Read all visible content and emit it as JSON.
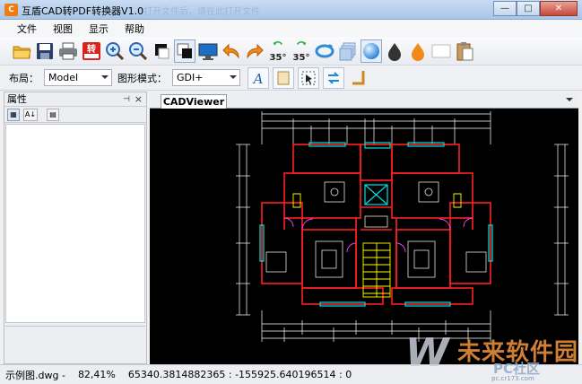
{
  "window": {
    "title": "互盾CAD转PDF转换器V1.0",
    "ghost_title": "打开文件后，请在此打开文件",
    "app_icon_text": "C",
    "btn_minimize": "—",
    "btn_maximize": "□",
    "btn_close": "✕"
  },
  "menu": {
    "items": [
      {
        "label": "文件"
      },
      {
        "label": "视图"
      },
      {
        "label": "显示"
      },
      {
        "label": "帮助"
      }
    ]
  },
  "toolbar": {
    "convert_label": "转",
    "rotate_left_label": "35°",
    "rotate_right_label": "35°",
    "icons": [
      "open-folder-icon",
      "save-icon",
      "print-icon",
      "convert-pdf-icon",
      "zoom-in-icon",
      "zoom-out-icon",
      "black-white-icon",
      "invert-color-icon",
      "monitor-icon",
      "undo-icon",
      "redo-icon",
      "rotate-left-35-icon",
      "rotate-right-35-icon",
      "rotate-icon",
      "layers-icon",
      "sphere-icon",
      "black-drop-icon",
      "orange-drop-icon",
      "white-rect-icon",
      "clipboard-icon"
    ]
  },
  "toolbar2": {
    "layout_label": "布局：",
    "layout_value": "Model",
    "render_label": "图形模式：",
    "render_value": "GDI+",
    "icons": [
      "text-font-icon",
      "page-icon",
      "cursor-select-icon",
      "swap-icon",
      "corner-line-icon"
    ]
  },
  "properties_panel": {
    "title": "属性",
    "pin": "⊣",
    "close": "×",
    "tools": [
      {
        "label": "▦",
        "name": "categorized-icon"
      },
      {
        "label": "A↓",
        "name": "sort-alpha-icon"
      },
      {
        "label": "▤",
        "name": "property-pages-icon"
      }
    ]
  },
  "document": {
    "tab_label": "CADViewer"
  },
  "status": {
    "filename": "示例图.dwg -",
    "zoom": "82,41%",
    "coords": "65340.3814882365 : -155925.640196514 : 0"
  },
  "watermark": {
    "mark": "W",
    "brand": "未来软件园",
    "community": "PC社区",
    "url": "pc.cr173.com"
  },
  "colors": {
    "cad_background": "#000000",
    "wall_red": "#ff2020",
    "dim_white": "#ffffff",
    "furniture_white": "#e0e0e0",
    "window_cyan": "#00e0e0",
    "stair_yellow": "#ffff00",
    "door_magenta": "#ff40ff",
    "title_bar_blue": "#b7d0ee"
  }
}
